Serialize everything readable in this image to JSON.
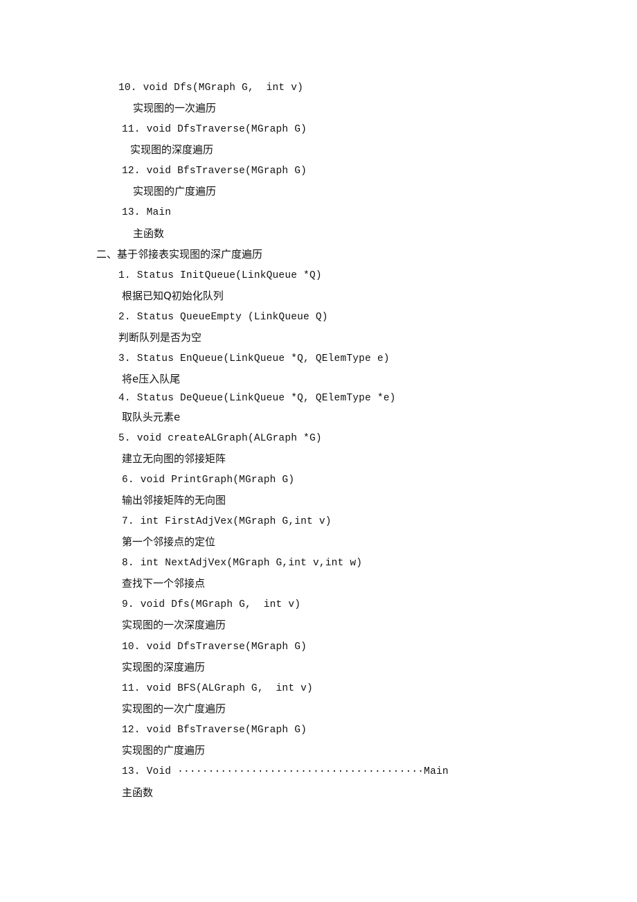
{
  "section1_tail": [
    {
      "signature": "10. void Dfs(MGraph G,  int v)",
      "description": "实现图的一次遍历"
    },
    {
      "signature": "11. void DfsTraverse(MGraph G)",
      "description": "实现图的深度遍历"
    },
    {
      "signature": "12. void BfsTraverse(MGraph G)",
      "description": "实现图的广度遍历"
    },
    {
      "signature": "13. Main",
      "description": "主函数"
    }
  ],
  "section2": {
    "heading": "二、基于邻接表实现图的深广度遍历",
    "items": [
      {
        "signature": "1. Status InitQueue(LinkQueue *Q)",
        "description": "根据已知Q初始化队列"
      },
      {
        "signature": "2. Status QueueEmpty (LinkQueue Q)",
        "description": "判断队列是否为空"
      },
      {
        "signature": "3. Status EnQueue(LinkQueue *Q, QElemType e)",
        "description": "将e压入队尾"
      },
      {
        "signature": "4. Status DeQueue(LinkQueue *Q, QElemType *e)",
        "description": "取队头元素e"
      },
      {
        "signature": "5. void createALGraph(ALGraph *G)",
        "description": "建立无向图的邻接矩阵"
      },
      {
        "signature": "6. void PrintGraph(MGraph G)",
        "description": "输出邻接矩阵的无向图"
      },
      {
        "signature": "7. int FirstAdjVex(MGraph G,int v)",
        "description": "第一个邻接点的定位"
      },
      {
        "signature": "8. int NextAdjVex(MGraph G,int v,int w)",
        "description": "查找下一个邻接点"
      },
      {
        "signature": "9. void Dfs(MGraph G,  int v)",
        "description": "实现图的一次深度遍历"
      },
      {
        "signature": "10. void DfsTraverse(MGraph G)",
        "description": "实现图的深度遍历"
      },
      {
        "signature": "11. void BFS(ALGraph G,  int v)",
        "description": "实现图的一次广度遍历"
      },
      {
        "signature": "12. void BfsTraverse(MGraph G)",
        "description": "实现图的广度遍历"
      },
      {
        "signature": "13. Void ········································Main",
        "description": "主函数"
      }
    ]
  }
}
